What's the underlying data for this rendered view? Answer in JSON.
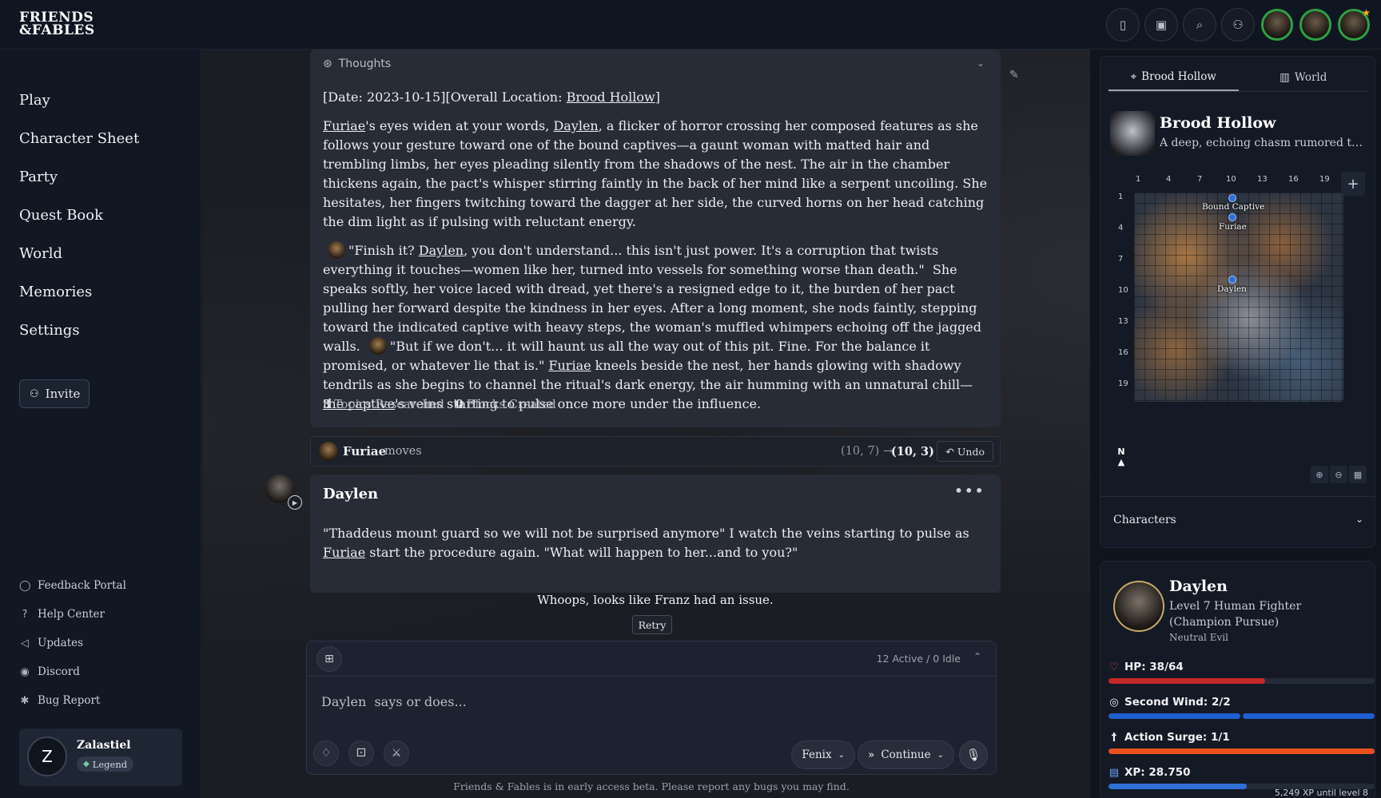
{
  "app": {
    "logo_line1": "FRIENDS",
    "logo_line2": "&FABLES"
  },
  "topbar": {
    "icons": [
      "sidebar-toggle-icon",
      "image-icon",
      "search-icon",
      "add-user-icon"
    ]
  },
  "sidebar": {
    "nav": [
      "Play",
      "Character Sheet",
      "Party",
      "Quest Book",
      "World",
      "Memories",
      "Settings"
    ],
    "invite_label": "Invite",
    "links": [
      {
        "label": "Feedback Portal",
        "icon": "chat-bubble-icon"
      },
      {
        "label": "Help Center",
        "icon": "help-circle-icon"
      },
      {
        "label": "Updates",
        "icon": "megaphone-icon"
      },
      {
        "label": "Discord",
        "icon": "discord-icon"
      },
      {
        "label": "Bug Report",
        "icon": "bug-icon"
      }
    ],
    "user": {
      "initial": "Z",
      "name": "Zalastiel",
      "badge": "Legend"
    }
  },
  "thoughts": {
    "label": "Thoughts",
    "topics_count": "3",
    "topics_label": "Topics Researched",
    "blocks_count": "0",
    "blocks_label": "Blocks Created"
  },
  "move": {
    "name": "Furiae",
    "verb": "moves",
    "from": "(10, 7) →",
    "to": "(10, 3)",
    "undo_label": "Undo"
  },
  "message": {
    "author": "Daylen",
    "text_a": "\"Thaddeus mount guard so we will not be surprised anymore\" I watch the veins starting to pulse as ",
    "text_link": "Furiae",
    "text_b": " start the procedure again. \"What will happen to her...and to you?\""
  },
  "error": {
    "text": "Whoops, looks like Franz had an issue.",
    "retry_label": "Retry"
  },
  "composer": {
    "status": "12 Active / 0 Idle",
    "placeholder": "Daylen  says or does...",
    "model_label": "Fenix",
    "continue_label": "Continue"
  },
  "footer_note": "Friends & Fables is in early access beta. Please report any bugs you may find.",
  "map_panel": {
    "tab_local": "Brood Hollow",
    "tab_world": "World",
    "location_name": "Brood Hollow",
    "location_desc": "A deep, echoing chasm rumored to be...",
    "col_labels": [
      "1",
      "4",
      "7",
      "10",
      "13",
      "16",
      "19"
    ],
    "row_labels": [
      "1",
      "4",
      "7",
      "10",
      "13",
      "16",
      "19"
    ],
    "tokens": [
      "Bound Captive",
      "Furiae",
      "Daylen"
    ],
    "compass": "N",
    "characters_label": "Characters"
  },
  "character": {
    "name": "Daylen",
    "class_line": "Level 7 Human Fighter (Champion Pursue)",
    "alignment": "Neutral Evil",
    "hp_label": "HP: 38/64",
    "hp_fraction": 0.59,
    "second_wind_label": "Second Wind: 2/2",
    "action_surge_label": "Action Surge: 1/1",
    "xp_label": "XP: 28.750",
    "xp_fraction": 0.52,
    "xp_note": "5,249 XP until level 8",
    "colors": {
      "hp": "#c62828",
      "second_wind": "#1f5fd1",
      "action_surge": "#e8501c",
      "xp": "#2f6fd6"
    }
  }
}
